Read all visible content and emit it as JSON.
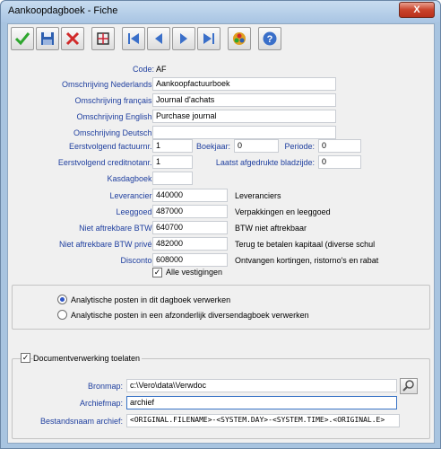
{
  "window": {
    "title": "Aankoopdagboek - Fiche",
    "close_label": "X"
  },
  "toolbar": {
    "buttons": [
      {
        "name": "confirm-icon",
        "color": "#2ea62e"
      },
      {
        "name": "save-icon",
        "color": "#2d5fb0"
      },
      {
        "name": "cancel-icon",
        "color": "#d12a2a"
      },
      {
        "name": "grid-icon",
        "color": "#333333"
      },
      {
        "name": "first-icon",
        "color": "#3a6fc9"
      },
      {
        "name": "previous-icon",
        "color": "#3a6fc9"
      },
      {
        "name": "next-icon",
        "color": "#3a6fc9"
      },
      {
        "name": "last-icon",
        "color": "#3a6fc9"
      },
      {
        "name": "color-wheel-icon",
        "color": "#e0a020"
      },
      {
        "name": "help-icon",
        "color": "#3a6fc9"
      }
    ]
  },
  "form": {
    "code_label": "Code:",
    "code_value": "AF",
    "omschr_nl_label": "Omschrijving Nederlands:",
    "omschr_nl_value": "Aankoopfactuurboek",
    "omschr_fr_label": "Omschrijving français:",
    "omschr_fr_value": "Journal d'achats",
    "omschr_en_label": "Omschrijving English:",
    "omschr_en_value": "Purchase journal",
    "omschr_de_label": "Omschrijving Deutsch:",
    "omschr_de_value": "",
    "eerst_factuur_label": "Eerstvolgend factuurnr.:",
    "eerst_factuur_value": "1",
    "boekjaar_label": "Boekjaar:",
    "boekjaar_value": "0",
    "periode_label": "Periode:",
    "periode_value": "0",
    "eerst_credit_label": "Eerstvolgend creditnotanr.:",
    "eerst_credit_value": "1",
    "laatst_label": "Laatst afgedrukte bladzijde:",
    "laatst_value": "0",
    "kasdagboek_label": "Kasdagboek:",
    "kasdagboek_value": "",
    "leverancier_label": "Leverancier:",
    "leverancier_value": "440000",
    "leverancier_desc": "Leveranciers",
    "leeggoed_label": "Leeggoed:",
    "leeggoed_value": "487000",
    "leeggoed_desc": "Verpakkingen en leeggoed",
    "btw_label": "Niet aftrekbare BTW:",
    "btw_value": "640700",
    "btw_desc": "BTW niet aftrekbaar",
    "btw_prive_label": "Niet aftrekbare BTW privé:",
    "btw_prive_value": "482000",
    "btw_prive_desc": "Terug te betalen kapitaal (diverse schul",
    "disconto_label": "Disconto:",
    "disconto_value": "608000",
    "disconto_desc": "Ontvangen kortingen, ristorno's en rabat",
    "alle_vestigingen_label": "Alle vestigingen",
    "alle_vestigingen_checked": true
  },
  "analytic": {
    "option1": "Analytische posten in dit dagboek verwerken",
    "option2": "Analytische posten in een afzonderlijk diversendagboek verwerken",
    "selected": 1
  },
  "document": {
    "enable_label": "Documentverwerking toelaten",
    "enable_checked": true,
    "bronmap_label": "Bronmap:",
    "bronmap_value": "c:\\Vero\\data\\Verwdoc",
    "archiefmap_label": "Archiefmap:",
    "archiefmap_value": "archief",
    "bestandsnaam_label": "Bestandsnaam archief:",
    "bestandsnaam_value": "<ORIGINAL.FILENAME>-<SYSTEM.DAY>-<SYSTEM.TIME>.<ORIGINAL.E>"
  }
}
